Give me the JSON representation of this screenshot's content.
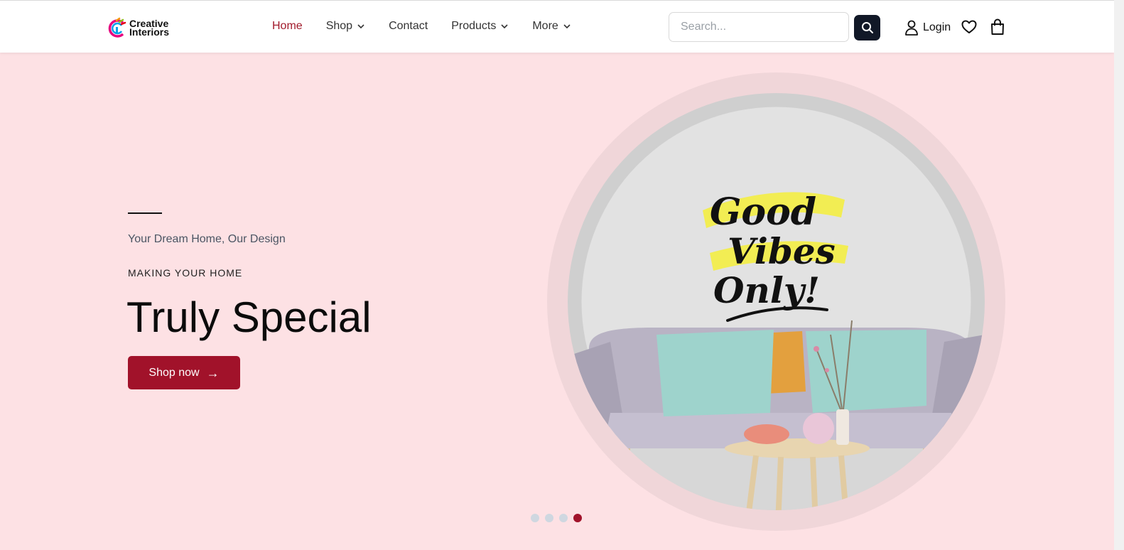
{
  "brand": {
    "name_line1": "Creative",
    "name_line2": "Interiors"
  },
  "nav": {
    "items": [
      {
        "label": "Home",
        "active": true,
        "dropdown": false
      },
      {
        "label": "Shop",
        "active": false,
        "dropdown": true
      },
      {
        "label": "Contact",
        "active": false,
        "dropdown": false
      },
      {
        "label": "Products",
        "active": false,
        "dropdown": true
      },
      {
        "label": "More",
        "active": false,
        "dropdown": true
      }
    ]
  },
  "search": {
    "placeholder": "Search...",
    "value": ""
  },
  "account": {
    "login_label": "Login"
  },
  "hero": {
    "tagline": "Your Dream Home, Our Design",
    "eyebrow": "MAKING YOUR HOME",
    "headline": "Truly Special",
    "cta_label": "Shop now",
    "cta_arrow": "→",
    "image_text": [
      "Good",
      "Vibes",
      "Only!"
    ]
  },
  "carousel": {
    "slides": 4,
    "active_index": 3
  },
  "colors": {
    "accent": "#a1122a",
    "hero_bg": "#fde1e4",
    "dark_button": "#111827"
  }
}
